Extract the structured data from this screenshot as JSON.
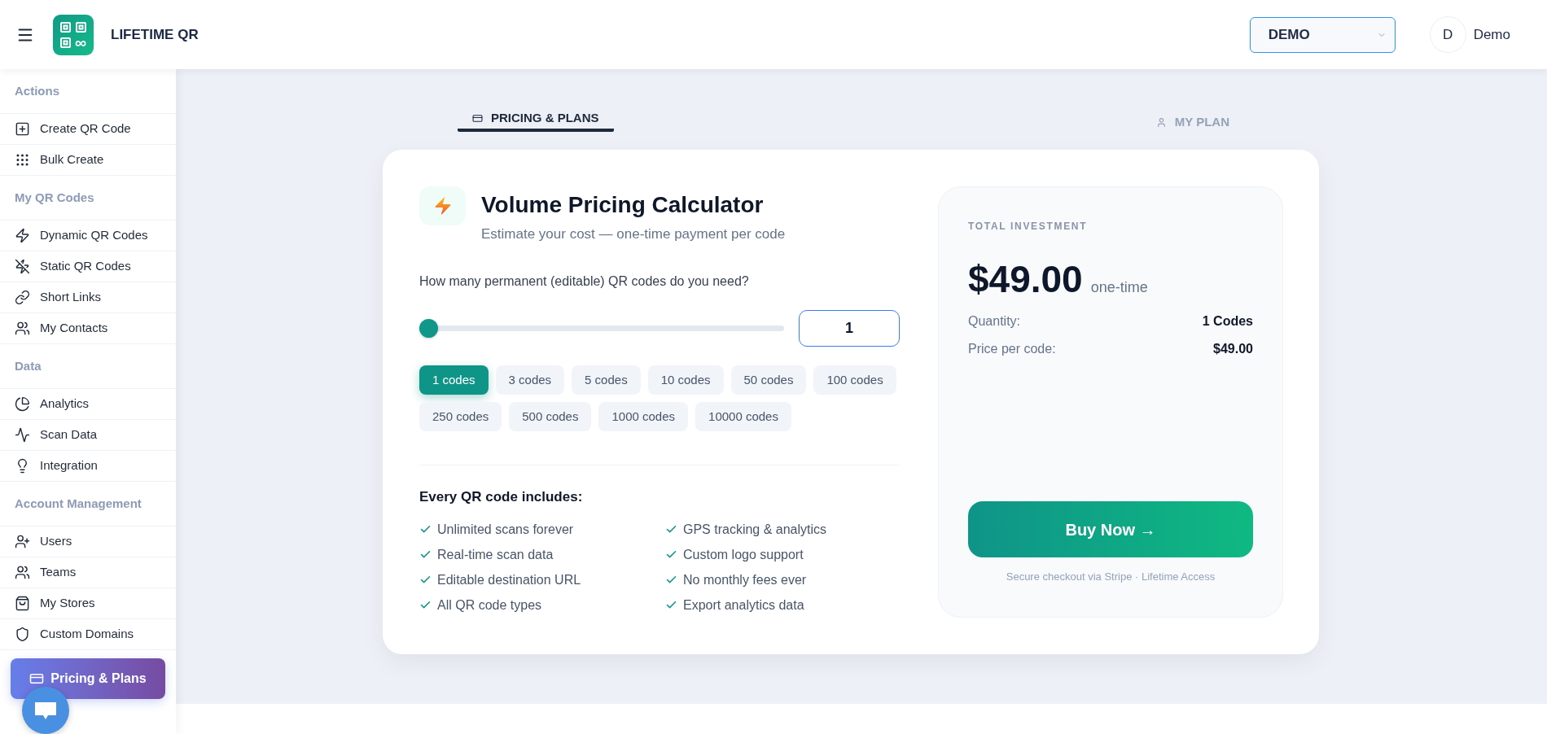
{
  "header": {
    "brand": "LIFETIME QR",
    "workspace_select": {
      "value": "DEMO"
    },
    "user": {
      "initial": "D",
      "name": "Demo"
    }
  },
  "sidebar": {
    "sections": [
      {
        "title": "Actions",
        "items": [
          "Create QR Code",
          "Bulk Create"
        ]
      },
      {
        "title": "My QR Codes",
        "items": [
          "Dynamic QR Codes",
          "Static QR Codes",
          "Short Links",
          "My Contacts"
        ]
      },
      {
        "title": "Data",
        "items": [
          "Analytics",
          "Scan Data",
          "Integration"
        ]
      },
      {
        "title": "Account Management",
        "items": [
          "Users",
          "Teams",
          "My Stores",
          "Custom Domains"
        ]
      }
    ],
    "cta_button": "Pricing & Plans"
  },
  "tabs": [
    {
      "label": "PRICING & PLANS",
      "selected": true
    },
    {
      "label": "MY PLAN",
      "selected": false
    }
  ],
  "calculator": {
    "title": "Volume Pricing Calculator",
    "subtitle": "Estimate your cost — one-time payment per code",
    "question": "How many permanent (editable) QR codes do you need?",
    "slider": {
      "level": 0
    },
    "quantity_input": {
      "value": "1"
    },
    "presets": [
      {
        "label": "1 codes",
        "selected": true
      },
      {
        "label": "3 codes",
        "selected": false
      },
      {
        "label": "5 codes",
        "selected": false
      },
      {
        "label": "10 codes",
        "selected": false
      },
      {
        "label": "50 codes",
        "selected": false
      },
      {
        "label": "100 codes",
        "selected": false
      },
      {
        "label": "250 codes",
        "selected": false
      },
      {
        "label": "500 codes",
        "selected": false
      },
      {
        "label": "1000 codes",
        "selected": false
      },
      {
        "label": "10000 codes",
        "selected": false
      }
    ],
    "features_title": "Every QR code includes:",
    "features": [
      "Unlimited scans forever",
      "GPS tracking & analytics",
      "Real-time scan data",
      "Custom logo support",
      "Editable destination URL",
      "No monthly fees ever",
      "All QR code types",
      "Export analytics data"
    ]
  },
  "summary": {
    "label": "TOTAL INVESTMENT",
    "total": "$49.00",
    "total_note": "one-time",
    "rows": [
      {
        "label": "Quantity:",
        "value": "1 Codes"
      },
      {
        "label": "Price per code:",
        "value": "$49.00"
      }
    ],
    "buy_button": "Buy Now →",
    "footnote": "Secure checkout via Stripe · Lifetime Access"
  }
}
